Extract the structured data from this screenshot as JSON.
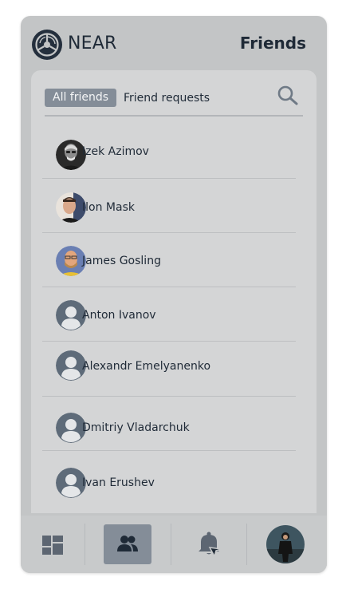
{
  "header": {
    "brand": "NEAR",
    "title": "Friends"
  },
  "tabs": [
    {
      "label": "All friends",
      "active": true
    },
    {
      "label": "Friend requests",
      "active": false
    }
  ],
  "friends": [
    {
      "name": "Izek Azimov",
      "avatar": "photo"
    },
    {
      "name": "Ilon Mask",
      "avatar": "photo"
    },
    {
      "name": "James Gosling",
      "avatar": "photo"
    },
    {
      "name": "Anton Ivanov",
      "avatar": "default"
    },
    {
      "name": "Alexandr Emelyanenko",
      "avatar": "default"
    },
    {
      "name": "Dmitriy Vladarchuk",
      "avatar": "default"
    },
    {
      "name": "Ivan Erushev",
      "avatar": "default"
    }
  ],
  "bottom_nav": [
    {
      "icon": "dashboard-icon",
      "active": false
    },
    {
      "icon": "friends-icon",
      "active": true
    },
    {
      "icon": "notifications-icon",
      "active": false
    },
    {
      "icon": "profile-avatar",
      "active": false
    }
  ],
  "colors": {
    "accent": "#848d98",
    "text": "#1f2a37",
    "background": "#c3c5c6",
    "panel": "#d4d5d6"
  }
}
